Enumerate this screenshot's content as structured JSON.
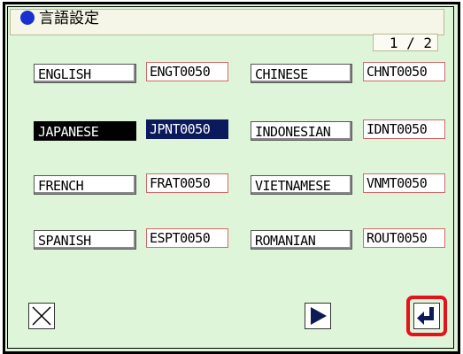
{
  "title": "言語設定",
  "page_indicator": "1 / 2",
  "languages": [
    {
      "name": "ENGLISH",
      "code": "ENGT0050",
      "selected": false
    },
    {
      "name": "CHINESE",
      "code": "CHNT0050",
      "selected": false
    },
    {
      "name": "JAPANESE",
      "code": "JPNT0050",
      "selected": true
    },
    {
      "name": "INDONESIAN",
      "code": "IDNT0050",
      "selected": false
    },
    {
      "name": "FRENCH",
      "code": "FRAT0050",
      "selected": false
    },
    {
      "name": "VIETNAMESE",
      "code": "VNMT0050",
      "selected": false
    },
    {
      "name": "SPANISH",
      "code": "ESPT0050",
      "selected": false
    },
    {
      "name": "ROMANIAN",
      "code": "ROUT0050",
      "selected": false
    }
  ],
  "buttons": {
    "cancel_icon": "close-icon",
    "next_icon": "play-right-icon",
    "enter_icon": "enter-return-icon"
  },
  "colors": {
    "background": "#dff5d9",
    "selected_bg": "#000000",
    "selected_code_bg": "#0a1a5c",
    "title_dot": "#1a2fd0",
    "highlight": "#e8101a"
  }
}
